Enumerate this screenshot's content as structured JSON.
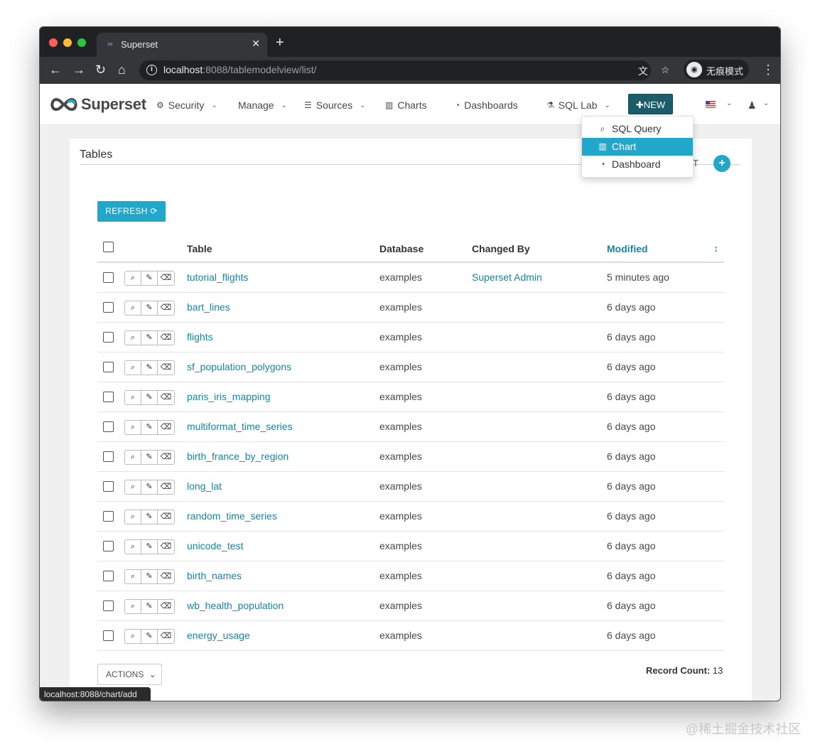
{
  "browser": {
    "tab_title": "Superset",
    "new_tab_label": "+",
    "url_host": "localhost",
    "url_rest": ":8088/tablemodelview/list/",
    "incognito_label": "无痕模式"
  },
  "navbar": {
    "brand": "Superset",
    "items": [
      {
        "label": "Security"
      },
      {
        "label": "Manage"
      },
      {
        "label": "Sources"
      },
      {
        "label": "Charts"
      },
      {
        "label": "Dashboards"
      },
      {
        "label": "SQL Lab"
      }
    ],
    "new_button": "NEW"
  },
  "new_menu": {
    "items": [
      {
        "label": "SQL Query"
      },
      {
        "label": "Chart"
      },
      {
        "label": "Dashboard"
      }
    ]
  },
  "panel": {
    "title": "Tables",
    "partial_text": "T",
    "add_label": "+"
  },
  "refresh_label": "REFRESH",
  "table": {
    "columns": [
      "Table",
      "Database",
      "Changed By",
      "Modified"
    ],
    "rows": [
      {
        "table": "tutorial_flights",
        "database": "examples",
        "changed_by": "Superset Admin",
        "modified": "5 minutes ago"
      },
      {
        "table": "bart_lines",
        "database": "examples",
        "changed_by": "",
        "modified": "6 days ago"
      },
      {
        "table": "flights",
        "database": "examples",
        "changed_by": "",
        "modified": "6 days ago"
      },
      {
        "table": "sf_population_polygons",
        "database": "examples",
        "changed_by": "",
        "modified": "6 days ago"
      },
      {
        "table": "paris_iris_mapping",
        "database": "examples",
        "changed_by": "",
        "modified": "6 days ago"
      },
      {
        "table": "multiformat_time_series",
        "database": "examples",
        "changed_by": "",
        "modified": "6 days ago"
      },
      {
        "table": "birth_france_by_region",
        "database": "examples",
        "changed_by": "",
        "modified": "6 days ago"
      },
      {
        "table": "long_lat",
        "database": "examples",
        "changed_by": "",
        "modified": "6 days ago"
      },
      {
        "table": "random_time_series",
        "database": "examples",
        "changed_by": "",
        "modified": "6 days ago"
      },
      {
        "table": "unicode_test",
        "database": "examples",
        "changed_by": "",
        "modified": "6 days ago"
      },
      {
        "table": "birth_names",
        "database": "examples",
        "changed_by": "",
        "modified": "6 days ago"
      },
      {
        "table": "wb_health_population",
        "database": "examples",
        "changed_by": "",
        "modified": "6 days ago"
      },
      {
        "table": "energy_usage",
        "database": "examples",
        "changed_by": "",
        "modified": "6 days ago"
      }
    ]
  },
  "actions_label": "ACTIONS",
  "record_count_label": "Record Count:",
  "record_count": "13",
  "status_bar_url": "localhost:8088/chart/add",
  "watermark": "@稀土掘金技术社区",
  "colors": {
    "accent": "#20a7c9",
    "link": "#1a85a0",
    "new_button": "#1d5d69"
  }
}
